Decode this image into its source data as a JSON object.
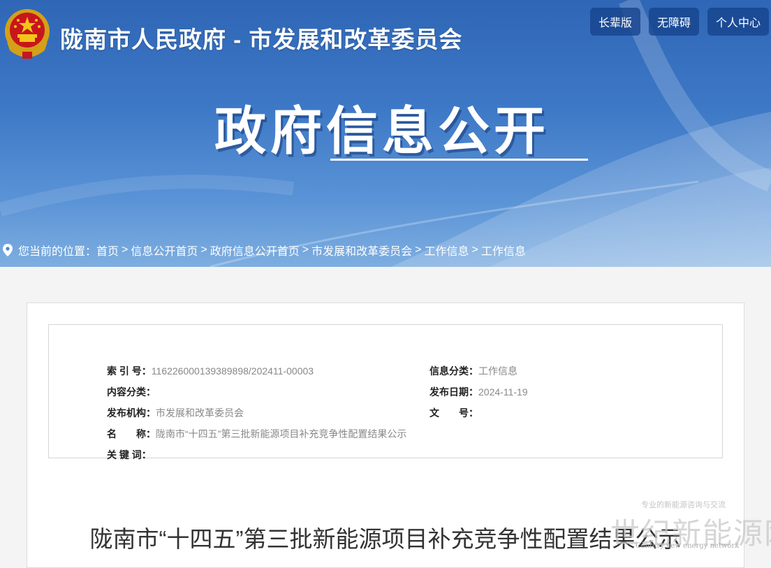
{
  "header": {
    "site_title": "陇南市人民政府 - 市发展和改革委员会",
    "buttons": [
      "长辈版",
      "无障碍",
      "个人中心"
    ],
    "hero_title": "政府信息公开"
  },
  "breadcrumb": {
    "prefix": "您当前的位置：",
    "items": [
      "首页",
      "信息公开首页",
      "政府信息公开首页",
      "市发展和改革委员会",
      "工作信息",
      "工作信息"
    ]
  },
  "meta": {
    "index_no": {
      "label": "索 引 号：",
      "value": "116226000139389898/202411-00003"
    },
    "category": {
      "label": "信息分类：",
      "value": "工作信息"
    },
    "content_class": {
      "label": "内容分类：",
      "value": ""
    },
    "publish_date": {
      "label": "发布日期：",
      "value": "2024-11-19"
    },
    "publisher": {
      "label": "发布机构：",
      "value": "市发展和改革委员会"
    },
    "doc_no": {
      "label": "文　　号：",
      "value": ""
    },
    "name": {
      "label": "名　　称：",
      "value": "陇南市“十四五”第三批新能源项目补充竞争性配置结果公示"
    },
    "keywords": {
      "label": "关 键 词：",
      "value": ""
    }
  },
  "document": {
    "title": "陇南市“十四五”第三批新能源项目补充竞争性配置结果公示"
  },
  "watermark": {
    "main": "世纪新能源网",
    "top": "专业的新能源咨询与交流",
    "english": "Century new energy network"
  },
  "colors": {
    "banner_blue": "#3d78c6",
    "button_bg": "#16428c",
    "label_text": "#222222",
    "value_text": "#888888"
  }
}
